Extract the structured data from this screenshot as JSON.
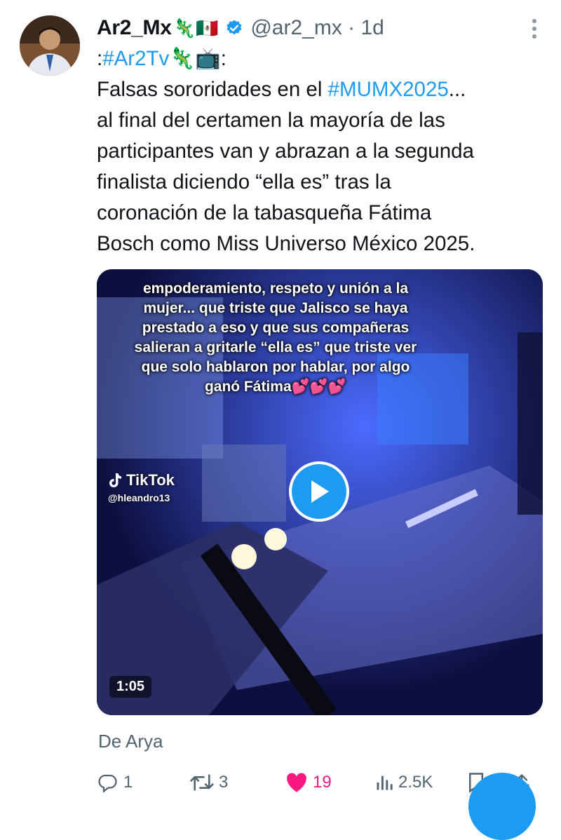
{
  "tweet": {
    "display_name": "Ar2_Mx",
    "name_emoji": "🦎🇲🇽",
    "handle_time": "@ar2_mx · 1d",
    "lines": [
      [
        {
          "t": ":",
          "tag": false
        },
        {
          "t": "#Ar2Tv",
          "tag": true
        },
        {
          "t": "🦎📺:",
          "tag": false
        }
      ],
      [
        {
          "t": "Falsas sororidades en el ",
          "tag": false
        },
        {
          "t": "#MUMX2025",
          "tag": true
        },
        {
          "t": "...",
          "tag": false
        }
      ],
      [
        {
          "t": "al final del certamen la mayoría de las",
          "tag": false
        }
      ],
      [
        {
          "t": "participantes van y abrazan a la segunda",
          "tag": false
        }
      ],
      [
        {
          "t": "finalista diciendo “ella es” tras la",
          "tag": false
        }
      ],
      [
        {
          "t": "coronación de la tabasqueña Fátima",
          "tag": false
        }
      ],
      [
        {
          "t": "Bosch como Miss Universo México 2025.",
          "tag": false
        }
      ]
    ]
  },
  "media": {
    "caption": "empoderamiento, respeto y unión a la mujer... que triste que Jalisco se haya prestado a eso y que sus compañeras salieran a gritarle “ella es” que triste ver que solo hablaron por hablar, por algo ganó Fátima💕💕💕",
    "watermark": "TikTok",
    "watermark_user": "@hleandro13",
    "duration": "1:05"
  },
  "source": "De Arya",
  "actions": {
    "replies": "1",
    "retweets": "3",
    "likes": "19",
    "views": "2.5K"
  },
  "colors": {
    "accent": "#1d9bf0",
    "like": "#f91880",
    "muted": "#536471"
  }
}
